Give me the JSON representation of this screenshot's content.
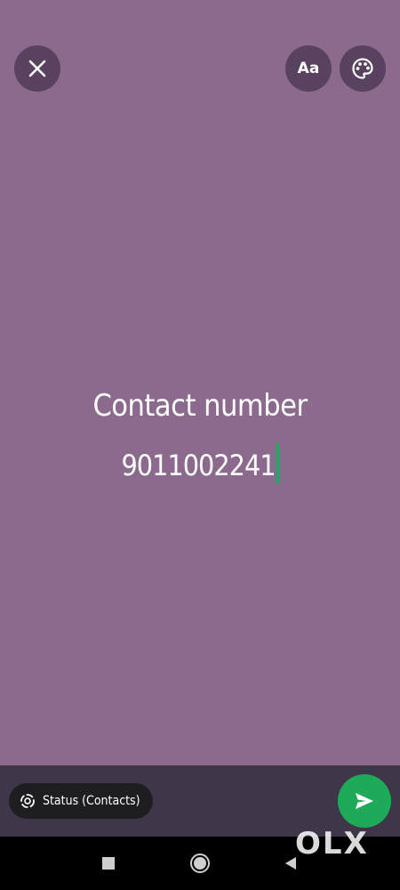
{
  "header": {
    "close_icon": "close-icon",
    "font_button_label": "Aa",
    "palette_icon": "palette-icon"
  },
  "status_text": {
    "line1": "Contact number",
    "line2": "9011002241"
  },
  "colors": {
    "background": "#8c6a8e",
    "accent": "#1faa59",
    "bottom_bar": "#3f3749"
  },
  "bottom_bar": {
    "audience_label": "Status (Contacts)",
    "audience_icon": "status-ring-icon",
    "send_icon": "send-icon"
  },
  "nav": {
    "recents_icon": "square-icon",
    "home_icon": "circle-icon",
    "back_icon": "back-triangle-icon"
  },
  "watermark": {
    "text": "OLX"
  }
}
